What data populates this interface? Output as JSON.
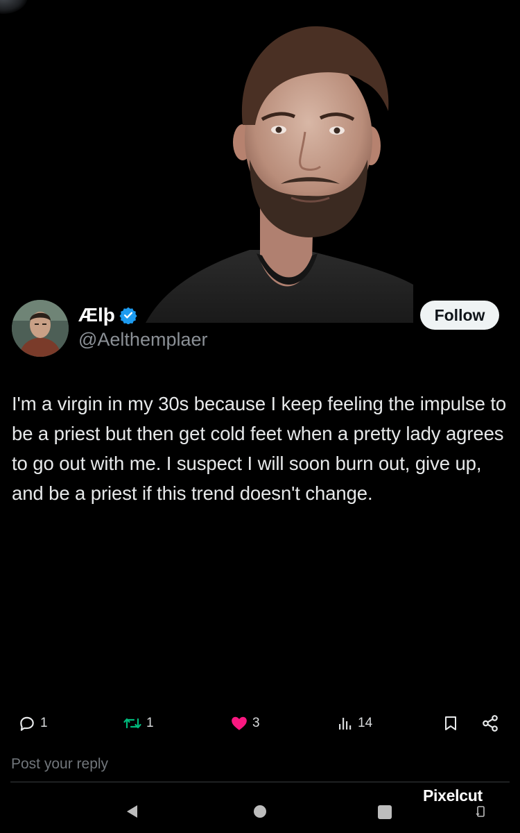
{
  "post": {
    "display_name": "Ælþ",
    "handle": "@Aelthemplaer",
    "verified_icon": "verified-badge-icon",
    "follow_label": "Follow",
    "text": "I'm a virgin in my 30s because I keep feeling the impulse to be a priest but then get cold feet when a pretty lady agrees to go out with me. I suspect I will soon burn out, give up, and be a priest if this trend doesn't change."
  },
  "actions": {
    "replies": "1",
    "reposts": "1",
    "likes": "3",
    "views": "14"
  },
  "icons": {
    "reply": "reply-icon",
    "repost": "repost-icon",
    "like": "heart-icon",
    "views": "views-chart-icon",
    "bookmark": "bookmark-icon",
    "share": "share-icon"
  },
  "colors": {
    "background": "#000000",
    "text": "#e7e9ea",
    "muted": "#71767b",
    "verified": "#1d9bf0",
    "repost": "#00ba7c",
    "like": "#f91880"
  },
  "reply": {
    "placeholder": "Post your reply"
  },
  "watermark": {
    "label": "Pixelcut"
  }
}
